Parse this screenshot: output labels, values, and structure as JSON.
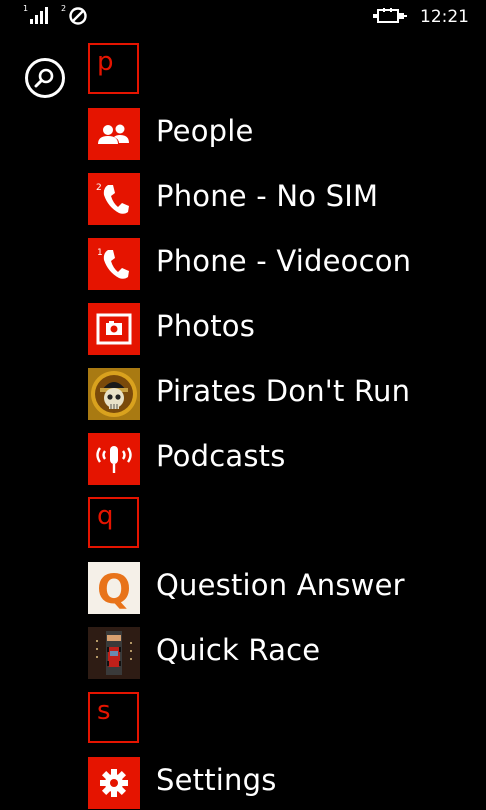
{
  "status_bar": {
    "sim1_label": "1",
    "sim2_label": "2",
    "time": "12:21"
  },
  "search": {
    "icon": "search-icon"
  },
  "groups": [
    {
      "letter": "p",
      "apps": [
        {
          "name": "People",
          "icon": "people-icon"
        },
        {
          "name": "Phone - No SIM",
          "icon": "phone-sim2-icon",
          "badge": "2"
        },
        {
          "name": "Phone - Videocon",
          "icon": "phone-sim1-icon",
          "badge": "1"
        },
        {
          "name": "Photos",
          "icon": "photos-icon"
        },
        {
          "name": "Pirates Don't Run",
          "icon": "pirate-skull-icon"
        },
        {
          "name": "Podcasts",
          "icon": "podcasts-icon"
        }
      ]
    },
    {
      "letter": "q",
      "apps": [
        {
          "name": "Question Answer",
          "icon": "question-answer-icon",
          "icon_letter": "Q"
        },
        {
          "name": "Quick Race",
          "icon": "quick-race-icon"
        }
      ]
    },
    {
      "letter": "s",
      "apps": [
        {
          "name": "Settings",
          "icon": "gear-icon"
        }
      ]
    }
  ],
  "colors": {
    "accent": "#e51400",
    "background": "#000000",
    "text": "#ffffff"
  }
}
